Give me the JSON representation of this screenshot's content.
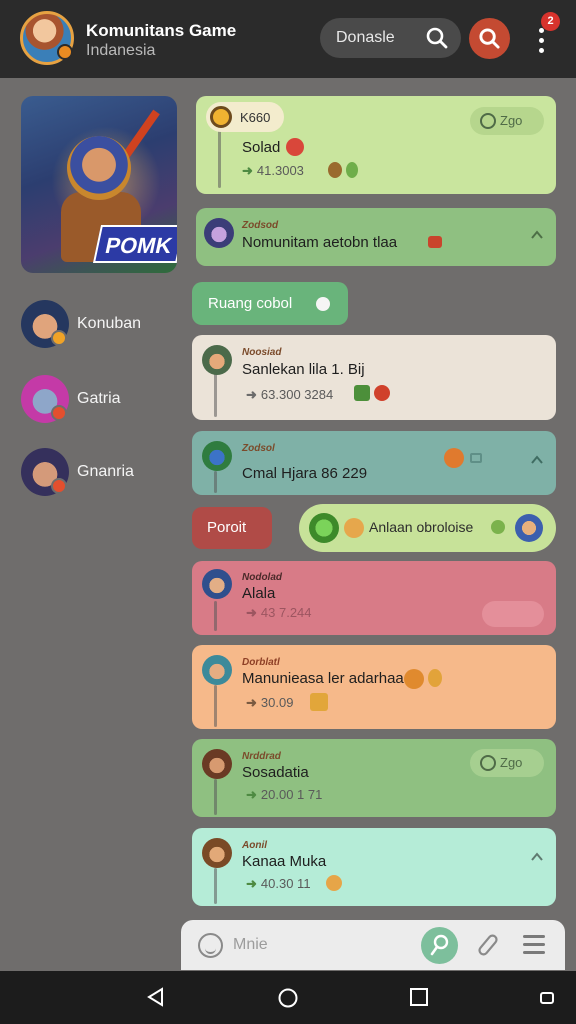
{
  "header": {
    "title": "Komunitans Game",
    "subtitle": "Indanesia",
    "search_label": "Donasle",
    "notification_count": "2"
  },
  "sidebar": {
    "feature_logo": "POMK",
    "items": [
      {
        "label": "Konuban"
      },
      {
        "label": "Gatria"
      },
      {
        "label": "Gnanria"
      }
    ]
  },
  "messages": [
    {
      "user": "K660",
      "text": "Solad",
      "meta": "41.3003",
      "action": "Zgo"
    },
    {
      "user": "Zodsod",
      "text": "Nomunitam aetobn tlaa",
      "meta": ""
    },
    {
      "user": "Noosiad",
      "text": "Sanlekan lila 1. Bij",
      "meta": "63.300 3284"
    },
    {
      "user": "Zodsol",
      "text": "Cmal Hjara 86 229",
      "meta": ""
    },
    {
      "user": "Nodolad",
      "text": "Alala",
      "meta": "43 7.244"
    },
    {
      "user": "Dorblatl",
      "text": "Manunieasa ler adarhaa",
      "meta": "30.09"
    },
    {
      "user": "Nrddrad",
      "text": "Sosadatia",
      "meta": "20.00 1 71",
      "action": "Zgo"
    },
    {
      "user": "Aonil",
      "text": "Kanaa Muka",
      "meta": "40.30 11"
    }
  ],
  "chips": {
    "green": "Ruang cobol",
    "red": "Poroit",
    "lime_text": "Anlaan obroloise"
  },
  "input": {
    "placeholder": "Mnie"
  },
  "colors": {
    "header_bg": "#2b2b2b",
    "accent_red": "#c44a32",
    "card_lime": "#c9e59e",
    "card_green": "#8fc081",
    "card_cream": "#ebe3d8",
    "card_teal": "#7fb1a7",
    "card_pink": "#d87b87",
    "card_orange": "#f6b98a",
    "card_mint": "#b5ecd7"
  },
  "icons": [
    "search-icon",
    "search-circle-icon",
    "more-vert-icon",
    "emoji-icon",
    "mic-icon",
    "attach-icon",
    "menu-icon",
    "back-icon",
    "home-icon",
    "recents-icon",
    "rotate-icon"
  ]
}
